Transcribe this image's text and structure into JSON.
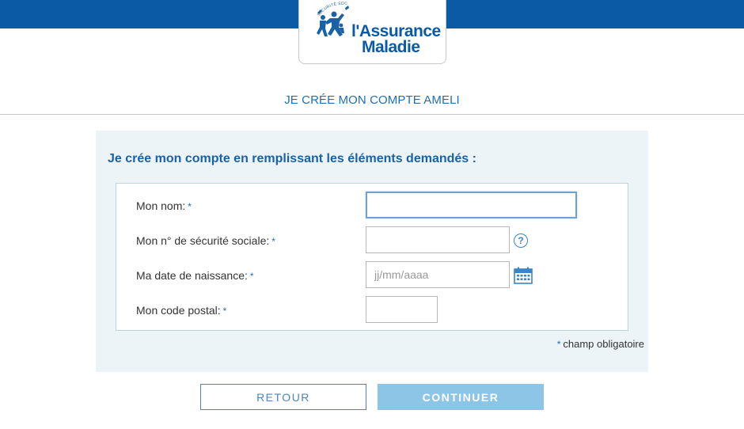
{
  "header": {
    "logo_emblem_text": "SÉCURITÉ SOCIALE",
    "logo_line1": "l'Assurance",
    "logo_line2": "Maladie"
  },
  "page": {
    "title": "JE CRÉE MON COMPTE AMELI"
  },
  "form": {
    "heading": "Je crée mon compte en remplissant les éléments demandés :",
    "required_marker": "*",
    "fields": [
      {
        "label": "Mon nom:",
        "value": "",
        "placeholder": ""
      },
      {
        "label": "Mon n° de sécurité sociale:",
        "value": "",
        "placeholder": ""
      },
      {
        "label": "Ma date de naissance:",
        "value": "",
        "placeholder": "jj/mm/aaaa"
      },
      {
        "label": "Mon code postal:",
        "value": "",
        "placeholder": ""
      }
    ],
    "help_icon_glyph": "?",
    "required_note": "champ obligatoire"
  },
  "actions": {
    "back_label": "RETOUR",
    "continue_label": "CONTINUER"
  },
  "colors": {
    "brand_blue": "#0b5aa6",
    "panel_bg": "#edf4f8",
    "continue_bg": "#8cc5e6"
  },
  "icons": {
    "help": "question-circle-icon",
    "calendar": "calendar-icon",
    "logo": "assurance-maladie-logo"
  }
}
